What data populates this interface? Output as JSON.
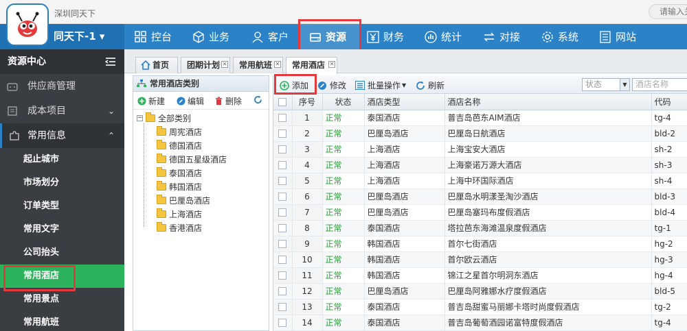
{
  "app": {
    "company": "深圳同天下",
    "top_search_placeholder": "请输入关",
    "user_menu_label": "同天下-1 ▾"
  },
  "nav": {
    "items": [
      {
        "label": "控台"
      },
      {
        "label": "业务"
      },
      {
        "label": "客户"
      },
      {
        "label": "资源"
      },
      {
        "label": "财务"
      },
      {
        "label": "统计"
      },
      {
        "label": "对接"
      },
      {
        "label": "系统"
      },
      {
        "label": "网站"
      }
    ],
    "active": "资源"
  },
  "sidebar": {
    "title": "资源中心",
    "sections": [
      {
        "label": "供应商管理"
      },
      {
        "label": "成本项目"
      },
      {
        "label": "常用信息"
      }
    ],
    "subitems": [
      {
        "label": "起止城市"
      },
      {
        "label": "市场划分"
      },
      {
        "label": "订单类型"
      },
      {
        "label": "常用文字"
      },
      {
        "label": "公司抬头"
      },
      {
        "label": "常用酒店"
      },
      {
        "label": "常用景点"
      },
      {
        "label": "常用航班"
      }
    ],
    "active": "常用酒店"
  },
  "tabs": [
    {
      "label": "首页"
    },
    {
      "label": "团期计划"
    },
    {
      "label": "常用航班"
    },
    {
      "label": "常用酒店"
    }
  ],
  "category_panel": {
    "title": "常用酒店类别",
    "toolbar": {
      "new": "新建",
      "edit": "编辑",
      "delete": "删除"
    },
    "root": "全部类别",
    "items": [
      "周宪酒店",
      "德国酒店",
      "德国五星级酒店",
      "泰国酒店",
      "韩国酒店",
      "巴厘岛酒店",
      "上海酒店",
      "香港酒店"
    ]
  },
  "grid_toolbar": {
    "add": "添加",
    "edit": "修改",
    "batch": "批量操作",
    "refresh": "刷新",
    "status_placeholder": "状态",
    "name_placeholder": "酒店名称"
  },
  "grid": {
    "columns": [
      "序号",
      "状态",
      "酒店类型",
      "酒店名称",
      "代码"
    ],
    "rows": [
      {
        "no": "1",
        "status": "正常",
        "type": "泰国酒店",
        "name": "普吉岛芭东AIM酒店",
        "code": "tg-4"
      },
      {
        "no": "2",
        "status": "正常",
        "type": "巴厘岛酒店",
        "name": "巴厘岛日航酒店",
        "code": "bld-2"
      },
      {
        "no": "3",
        "status": "正常",
        "type": "上海酒店",
        "name": "上海宝安大酒店",
        "code": "sh-2"
      },
      {
        "no": "4",
        "status": "正常",
        "type": "上海酒店",
        "name": "上海豪诺万源大酒店",
        "code": "sh-3"
      },
      {
        "no": "5",
        "status": "正常",
        "type": "上海酒店",
        "name": "上海中环国际酒店",
        "code": "sh-4"
      },
      {
        "no": "6",
        "status": "正常",
        "type": "巴厘岛酒店",
        "name": "巴厘岛水明漾圣淘沙酒店",
        "code": "bld-3"
      },
      {
        "no": "7",
        "status": "正常",
        "type": "巴厘岛酒店",
        "name": "巴厘岛塞玛布度假酒店",
        "code": "bld-4"
      },
      {
        "no": "8",
        "status": "正常",
        "type": "泰国酒店",
        "name": "塔拉芭东海滩温泉度假酒店",
        "code": "tg-1"
      },
      {
        "no": "9",
        "status": "正常",
        "type": "韩国酒店",
        "name": "首尔七街酒店",
        "code": "hg-2"
      },
      {
        "no": "10",
        "status": "正常",
        "type": "韩国酒店",
        "name": "首尔欧云酒店",
        "code": "hg-3"
      },
      {
        "no": "11",
        "status": "正常",
        "type": "韩国酒店",
        "name": "锦江之星首尔明洞东酒店",
        "code": "hg-4"
      },
      {
        "no": "12",
        "status": "正常",
        "type": "巴厘岛酒店",
        "name": "巴厘岛阿雅娜水疗度假酒店",
        "code": "bld-5"
      },
      {
        "no": "13",
        "status": "正常",
        "type": "泰国酒店",
        "name": "普吉岛甜蜜马丽娜卡塔时尚度假酒店",
        "code": "tg-2"
      },
      {
        "no": "14",
        "status": "正常",
        "type": "泰国酒店",
        "name": "普吉岛葡萄酒园诺富特度假酒店",
        "code": "tg-4"
      }
    ]
  },
  "colors": {
    "nav_blue": "#2b82c6",
    "sidebar_dark": "#3a3d42",
    "active_green": "#2cb35b",
    "status_green": "#23a030",
    "highlight_red": "#e4393c"
  }
}
